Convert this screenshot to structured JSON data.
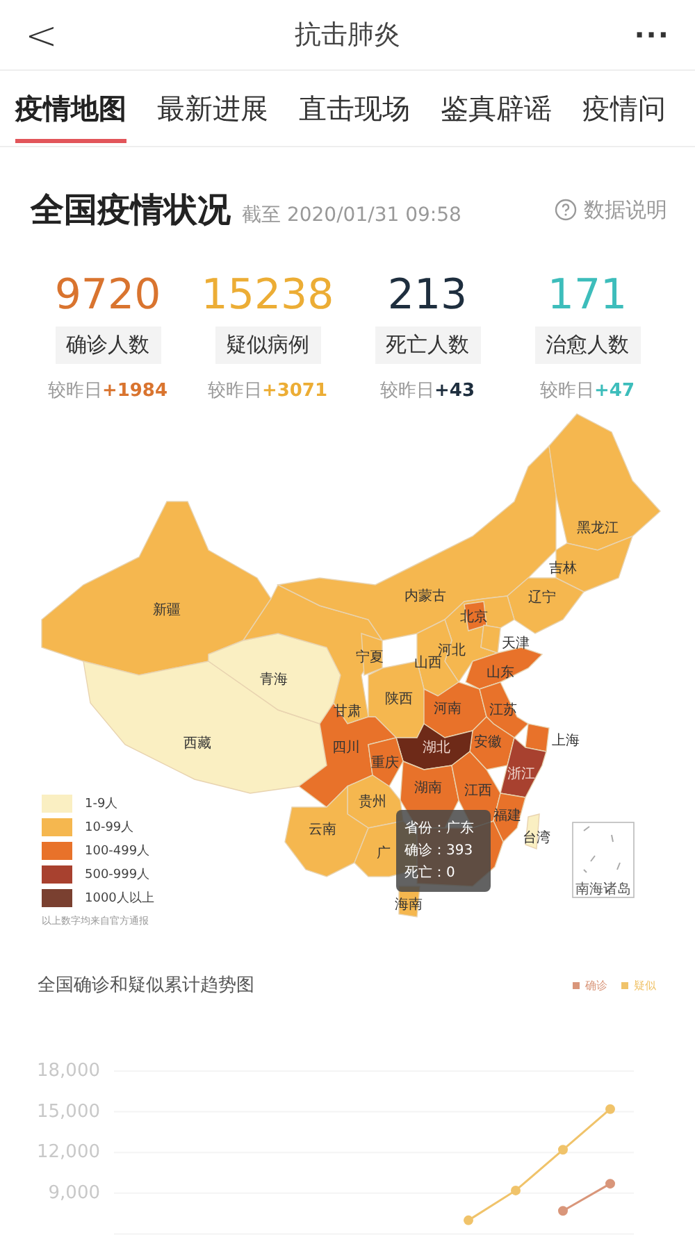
{
  "header": {
    "back": "<",
    "title": "抗击肺炎",
    "more": "···"
  },
  "tabs": [
    {
      "label": "疫情地图",
      "selected": true
    },
    {
      "label": "最新进展",
      "selected": false
    },
    {
      "label": "直击现场",
      "selected": false
    },
    {
      "label": "鉴真辟谣",
      "selected": false
    },
    {
      "label": "疫情问",
      "selected": false
    }
  ],
  "summary": {
    "title": "全国疫情状况",
    "timestamp": "截至 2020/01/31 09:58",
    "help": "数据说明",
    "stats": [
      {
        "value": "9720",
        "label": "确诊人数",
        "compare": "较昨日",
        "delta": "+1984",
        "color": "#d9742f"
      },
      {
        "value": "15238",
        "label": "疑似病例",
        "compare": "较昨日",
        "delta": "+3071",
        "color": "#ecad35"
      },
      {
        "value": "213",
        "label": "死亡人数",
        "compare": "较昨日",
        "delta": "+43",
        "color": "#1e2e3e"
      },
      {
        "value": "171",
        "label": "治愈人数",
        "compare": "较昨日",
        "delta": "+47",
        "color": "#3dbdbb"
      }
    ]
  },
  "map": {
    "provinces": [
      {
        "name": "新疆",
        "color": "#f5b74f"
      },
      {
        "name": "西藏",
        "color": "#faefc2"
      },
      {
        "name": "青海",
        "color": "#faefc2"
      },
      {
        "name": "甘肃",
        "color": "#f5b74f"
      },
      {
        "name": "内蒙古",
        "color": "#f5b74f"
      },
      {
        "name": "黑龙江",
        "color": "#f5b74f"
      },
      {
        "name": "吉林",
        "color": "#f5b74f"
      },
      {
        "name": "辽宁",
        "color": "#f5b74f"
      },
      {
        "name": "河北",
        "color": "#f5b74f"
      },
      {
        "name": "北京",
        "color": "#e8722a"
      },
      {
        "name": "天津",
        "color": "#f5b74f"
      },
      {
        "name": "山西",
        "color": "#f5b74f"
      },
      {
        "name": "山东",
        "color": "#e8722a"
      },
      {
        "name": "宁夏",
        "color": "#f5b74f"
      },
      {
        "name": "陕西",
        "color": "#f5b74f"
      },
      {
        "name": "河南",
        "color": "#e8722a"
      },
      {
        "name": "江苏",
        "color": "#e8722a"
      },
      {
        "name": "安徽",
        "color": "#e8722a"
      },
      {
        "name": "上海",
        "color": "#e8722a"
      },
      {
        "name": "浙江",
        "color": "#a8412f"
      },
      {
        "name": "四川",
        "color": "#e8722a"
      },
      {
        "name": "湖北",
        "color": "#6e2a18"
      },
      {
        "name": "重庆",
        "color": "#e8722a"
      },
      {
        "name": "湖南",
        "color": "#e8722a"
      },
      {
        "name": "江西",
        "color": "#e8722a"
      },
      {
        "name": "福建",
        "color": "#e8722a"
      },
      {
        "name": "贵州",
        "color": "#f5b74f"
      },
      {
        "name": "云南",
        "color": "#f5b74f"
      },
      {
        "name": "广",
        "color": "#f5b74f"
      },
      {
        "color": "#e8722a"
      },
      {
        "name": "海南",
        "color": "#f5b74f"
      },
      {
        "name": "台湾",
        "color": "#faefc2"
      }
    ],
    "inset": "南海诸岛",
    "legend": [
      {
        "label": "1-9人",
        "color": "#faefc2"
      },
      {
        "label": "10-99人",
        "color": "#f5b74f"
      },
      {
        "label": "100-499人",
        "color": "#e8722a"
      },
      {
        "label": "500-999人",
        "color": "#a8412f"
      },
      {
        "label": "1000人以上",
        "color": "#7a4030"
      }
    ],
    "note": "以上数字均来自官方通报",
    "tooltip": [
      "省份：广东",
      "确诊：393",
      "死亡：0"
    ]
  },
  "trend": {
    "chart_data": {
      "type": "line",
      "title": "全国确诊和疑似累计趋势图",
      "ylim": [
        6000,
        18000
      ],
      "grid": true,
      "yticks": [
        {
          "value": 18000,
          "label": "18,000"
        },
        {
          "value": 15000,
          "label": "15,000"
        },
        {
          "value": 12000,
          "label": "12,000"
        },
        {
          "value": 9000,
          "label": "9,000"
        }
      ],
      "series": [
        {
          "name": "确诊",
          "color": "#d9967a",
          "marker": "o",
          "values": [
            null,
            null,
            null,
            null,
            null,
            null,
            null,
            null,
            null,
            7700,
            9700
          ]
        },
        {
          "name": "疑似",
          "color": "#f0c36a",
          "marker": "o",
          "values": [
            null,
            null,
            null,
            null,
            null,
            null,
            null,
            7000,
            9200,
            12200,
            15200
          ]
        }
      ]
    }
  }
}
